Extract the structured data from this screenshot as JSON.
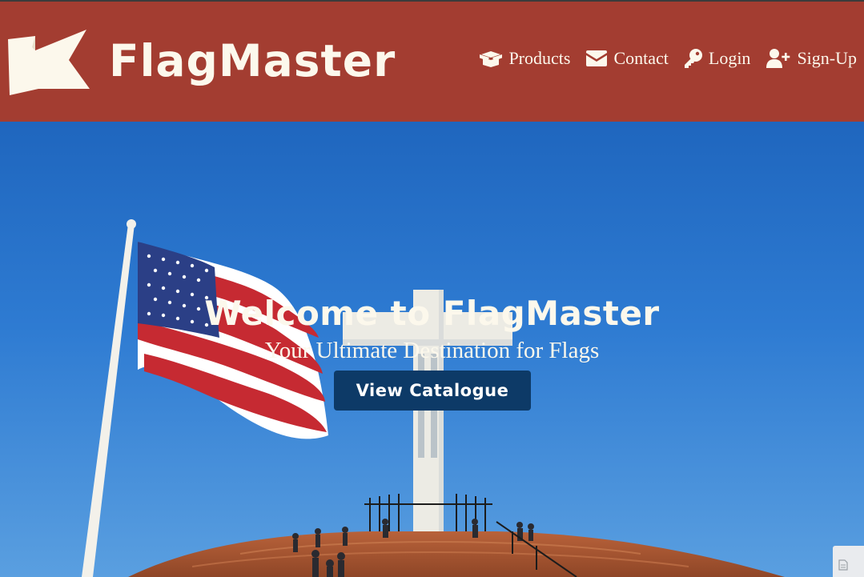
{
  "brand": {
    "name": "FlagMaster",
    "logo_icon": "flag-icon"
  },
  "nav": {
    "items": [
      {
        "label": "Products",
        "icon": "box-open-icon"
      },
      {
        "label": "Contact",
        "icon": "envelope-icon"
      },
      {
        "label": "Login",
        "icon": "key-icon"
      },
      {
        "label": "Sign-Up",
        "icon": "user-plus-icon"
      }
    ]
  },
  "hero": {
    "title": "Welcome to FlagMaster",
    "subtitle": "Your Ultimate Destination for Flags",
    "cta_label": "View Catalogue"
  },
  "colors": {
    "navbar": "#a33d31",
    "cream": "#fcf8ec",
    "cta": "#0d3a67",
    "sky": "#2a6fc4"
  }
}
